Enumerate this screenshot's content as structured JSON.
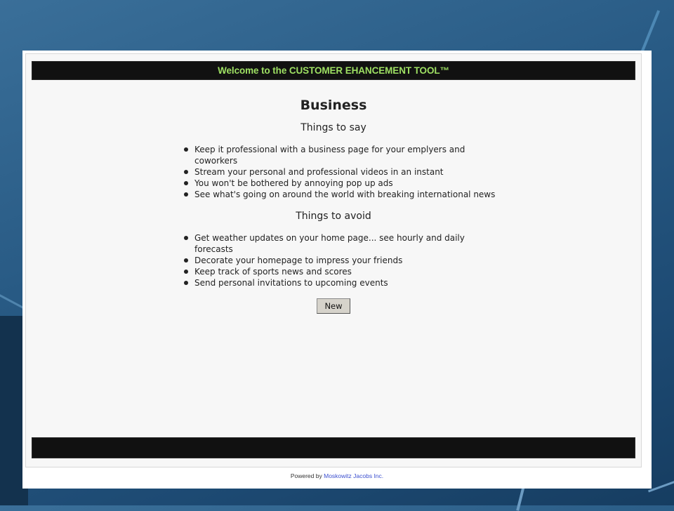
{
  "header": {
    "title": "Welcome to the CUSTOMER EHANCEMENT TOOL™"
  },
  "page": {
    "title": "Business"
  },
  "things_to_say": {
    "heading": "Things to say",
    "items": [
      "Keep it professional with a business page for your emplyers and coworkers",
      "Stream your personal and professional videos in an instant",
      "You won't be bothered by annoying pop up ads",
      "See what's going on around the world with breaking international news"
    ]
  },
  "things_to_avoid": {
    "heading": "Things to avoid",
    "items": [
      "Get weather updates on your home page... see hourly and daily forecasts",
      "Decorate your homepage to impress your friends",
      "Keep track of sports news and scores",
      "Send personal invitations to upcoming events"
    ]
  },
  "actions": {
    "new_label": "New"
  },
  "footer": {
    "powered_by": "Powered by",
    "company": "Moskowitz Jacobs Inc."
  },
  "colors": {
    "header_text": "#9ee063",
    "bar_background": "#111111",
    "link": "#3b4fcf",
    "button_face": "#d6d3cb"
  }
}
